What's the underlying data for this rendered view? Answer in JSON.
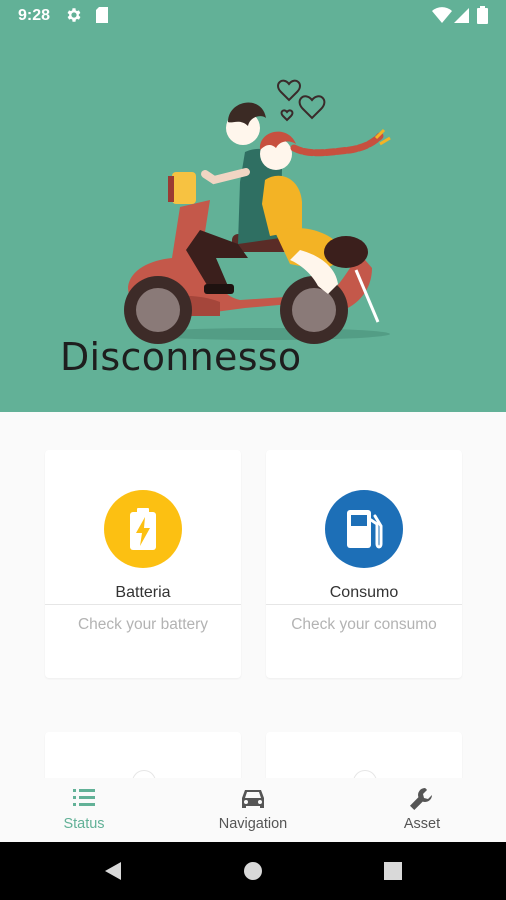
{
  "status_bar": {
    "time": "9:28",
    "icons": [
      "gear-icon",
      "sd-card-icon",
      "wifi-icon",
      "signal-icon",
      "battery-icon"
    ]
  },
  "hero": {
    "background_color": "#62b197",
    "title": "Disconnesso",
    "illustration": "couple-on-scooter"
  },
  "cards": [
    {
      "title": "Batteria",
      "subtitle": "Check your battery",
      "icon": "battery-bolt-icon",
      "color": "#fcc012"
    },
    {
      "title": "Consumo",
      "subtitle": "Check your consumo",
      "icon": "fuel-pump-icon",
      "color": "#1d6fb7"
    }
  ],
  "bottom_nav": {
    "items": [
      {
        "label": "Status",
        "icon": "list-icon",
        "active": true
      },
      {
        "label": "Navigation",
        "icon": "car-icon",
        "active": false
      },
      {
        "label": "Asset",
        "icon": "wrench-icon",
        "active": false
      }
    ],
    "active_color": "#62b197",
    "inactive_color": "#555555"
  },
  "system_nav": {
    "icons": [
      "back-icon",
      "home-icon",
      "recents-icon"
    ]
  }
}
